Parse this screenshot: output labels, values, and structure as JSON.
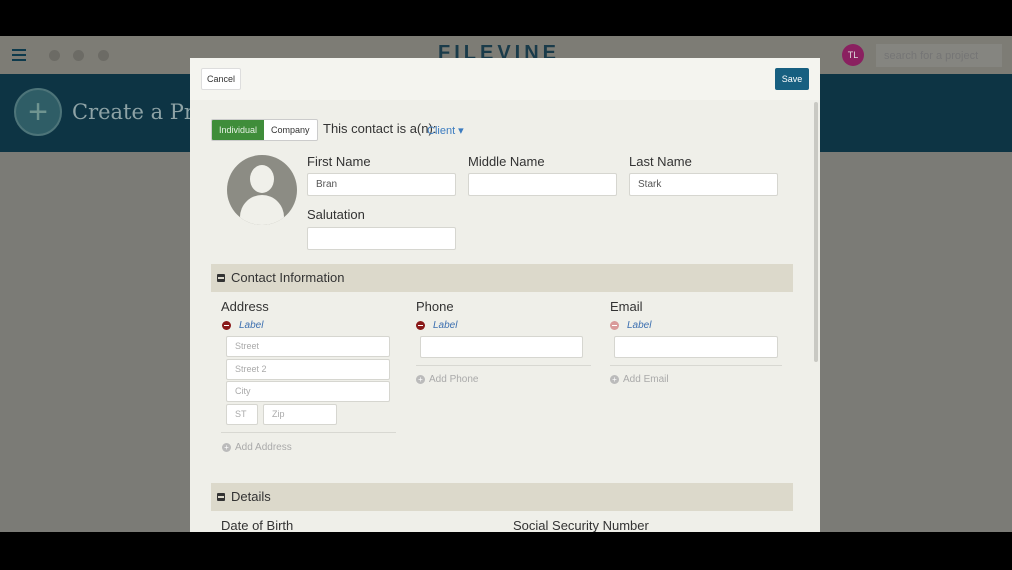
{
  "nav": {
    "logo": "FILEVINE",
    "avatar_initials": "TL",
    "search_placeholder": "search for a project"
  },
  "banner": {
    "title": "Create a Project"
  },
  "modal": {
    "cancel": "Cancel",
    "save": "Save",
    "type_options": [
      "Individual",
      "Company"
    ],
    "type_selected": "Individual",
    "contact_is": "This contact is a(n):",
    "contact_role": "Client ▾",
    "first_name_label": "First Name",
    "first_name": "Bran",
    "middle_name_label": "Middle Name",
    "middle_name": "",
    "last_name_label": "Last Name",
    "last_name": "Stark",
    "salutation_label": "Salutation",
    "salutation": "",
    "contact_section": "Contact Information",
    "address_label": "Address",
    "phone_label": "Phone",
    "email_label": "Email",
    "label_text": "Label",
    "street": "Street",
    "street2": "Street 2",
    "city": "City",
    "state": "ST",
    "zip": "Zip",
    "add_address": "Add Address",
    "add_phone": "Add Phone",
    "add_email": "Add Email",
    "details_section": "Details",
    "dob_label": "Date of Birth",
    "ssn_label": "Social Security Number"
  },
  "colors": {
    "accent": "#175f80",
    "individual": "#3f8d3a",
    "banner": "#0d3444",
    "remove": "#8a1a1a"
  }
}
